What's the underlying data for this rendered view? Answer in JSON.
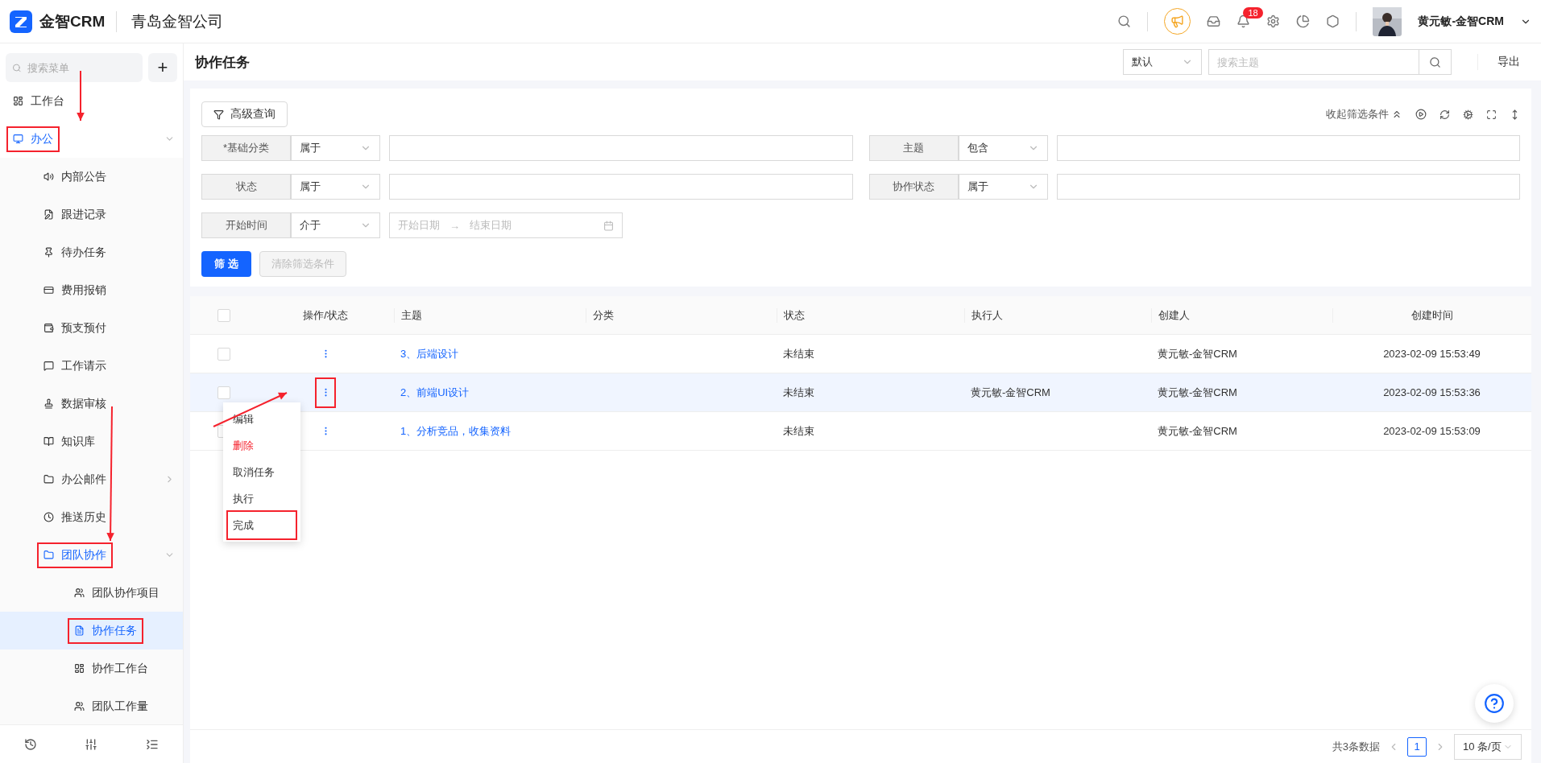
{
  "app": {
    "brand": "金智CRM",
    "company": "青岛金智公司"
  },
  "topbar": {
    "notification_count": "18",
    "user": "黄元敏-金智CRM"
  },
  "sidebar": {
    "search_placeholder": "搜索菜单",
    "add": "+",
    "items": [
      {
        "label": "工作台",
        "selected": false
      },
      {
        "label": "办公",
        "selected": false,
        "expanded": true,
        "annotated": true,
        "children": [
          {
            "label": "内部公告",
            "selected": false
          },
          {
            "label": "跟进记录",
            "selected": false
          },
          {
            "label": "待办任务",
            "selected": false
          },
          {
            "label": "费用报销",
            "selected": false
          },
          {
            "label": "预支预付",
            "selected": false
          },
          {
            "label": "工作请示",
            "selected": false
          },
          {
            "label": "数据审核",
            "selected": false
          },
          {
            "label": "知识库",
            "selected": false
          },
          {
            "label": "办公邮件",
            "selected": false,
            "expanded": false
          },
          {
            "label": "推送历史",
            "selected": false
          },
          {
            "label": "团队协作",
            "selected": false,
            "expanded": true,
            "annotated": true,
            "children": [
              {
                "label": "团队协作项目",
                "selected": false
              },
              {
                "label": "协作任务",
                "selected": true,
                "annotated": true
              },
              {
                "label": "协作工作台",
                "selected": false
              },
              {
                "label": "团队工作量",
                "selected": false
              }
            ]
          }
        ]
      }
    ]
  },
  "page": {
    "title": "协作任务",
    "view": "默认",
    "search_placeholder": "搜索主题",
    "export": "导出"
  },
  "filters": {
    "advanced": "高级查询",
    "collapse": "收起筛选条件",
    "fields": [
      {
        "kind": "text",
        "label": "*基础分类",
        "operator": "属于"
      },
      {
        "kind": "text",
        "label": "主题",
        "operator": "包含"
      },
      {
        "kind": "text",
        "label": "状态",
        "operator": "属于"
      },
      {
        "kind": "text",
        "label": "协作状态",
        "operator": "属于"
      },
      {
        "kind": "daterange",
        "label": "开始时间",
        "operator": "介于",
        "start_placeholder": "开始日期",
        "arrow": "→",
        "end_placeholder": "结束日期"
      }
    ],
    "apply": "筛 选",
    "clear": "清除筛选条件",
    "clear_disabled": true
  },
  "table": {
    "select_all_checked": false,
    "columns": [
      "操作/状态",
      "主题",
      "分类",
      "状态",
      "执行人",
      "创建人",
      "创建时间"
    ],
    "rows": [
      {
        "checked": false,
        "hovered": false,
        "annotated": false,
        "subject": "3、后端设计",
        "status": "未结束",
        "executor": "",
        "creator": "黄元敏-金智CRM",
        "created": "2023-02-09 15:53:49"
      },
      {
        "checked": false,
        "hovered": true,
        "annotated": true,
        "subject": "2、前端UI设计",
        "status": "未结束",
        "executor": "黄元敏-金智CRM",
        "creator": "黄元敏-金智CRM",
        "created": "2023-02-09 15:53:36"
      },
      {
        "checked": false,
        "hovered": false,
        "annotated": false,
        "subject": "1、分析竞品，收集资料",
        "status": "未结束",
        "executor": "",
        "creator": "黄元敏-金智CRM",
        "created": "2023-02-09 15:53:09"
      }
    ],
    "menu": [
      {
        "label": "编辑",
        "kind": "normal",
        "annotated": false
      },
      {
        "label": "删除",
        "kind": "danger",
        "annotated": false
      },
      {
        "label": "取消任务",
        "kind": "normal",
        "annotated": false
      },
      {
        "label": "执行",
        "kind": "normal",
        "annotated": false
      },
      {
        "label": "完成",
        "kind": "normal",
        "annotated": true
      }
    ]
  },
  "pagination": {
    "total": "共3条数据",
    "pages": [
      {
        "label": "1",
        "selected": true
      }
    ],
    "page_size": "10 条/页"
  }
}
